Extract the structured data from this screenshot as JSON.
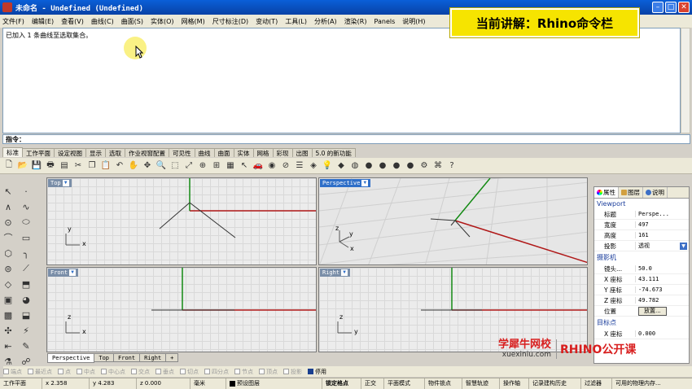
{
  "window": {
    "title": "未命名 - Undefined (Undefined)"
  },
  "menu": [
    "文件(F)",
    "编辑(E)",
    "查看(V)",
    "曲线(C)",
    "曲面(S)",
    "实体(O)",
    "网格(M)",
    "尺寸标注(D)",
    "变动(T)",
    "工具(L)",
    "分析(A)",
    "渲染(R)",
    "Panels",
    "说明(H)"
  ],
  "banner": {
    "text": "当前讲解：Rhino命令栏"
  },
  "history": {
    "line1": "已加入 1 条曲线至选取集合。"
  },
  "command": {
    "prompt": "指令："
  },
  "toolbar_tabs": [
    "标准",
    "工作平面",
    "设定视图",
    "显示",
    "选取",
    "作业视窗配置",
    "可见性",
    "曲线",
    "曲面",
    "实体",
    "网格",
    "彩现",
    "出图",
    "5.0 的新功能"
  ],
  "viewports": {
    "top": "Top",
    "perspective": "Perspective",
    "front": "Front",
    "right": "Right"
  },
  "axis_labels": {
    "x": "x",
    "y": "y",
    "z": "z"
  },
  "viewport_tabs": [
    "Perspective",
    "Top",
    "Front",
    "Right",
    "+"
  ],
  "panel": {
    "tabs": [
      "属性",
      "图层",
      "说明"
    ],
    "section_viewport": "Viewport",
    "rows_viewport": [
      {
        "key": "标题",
        "value": "Perspe..."
      },
      {
        "key": "宽度",
        "value": "497"
      },
      {
        "key": "高度",
        "value": "161"
      },
      {
        "key": "投影",
        "value": "透视"
      }
    ],
    "section_camera": "摄影机",
    "rows_camera": [
      {
        "key": "镜头...",
        "value": "50.0"
      },
      {
        "key": "X 座标",
        "value": "43.111"
      },
      {
        "key": "Y 座标",
        "value": "-74.673"
      },
      {
        "key": "Z 座标",
        "value": "49.782"
      }
    ],
    "position_label": "位置",
    "position_button": "放置...",
    "section_target": "目标点",
    "rows_target": [
      {
        "key": "X 座标",
        "value": "0.000"
      }
    ]
  },
  "osnap": [
    {
      "label": "端点",
      "on": false
    },
    {
      "label": "最近点",
      "on": false
    },
    {
      "label": "点",
      "on": false
    },
    {
      "label": "中点",
      "on": false
    },
    {
      "label": "中心点",
      "on": false
    },
    {
      "label": "交点",
      "on": false
    },
    {
      "label": "垂点",
      "on": false
    },
    {
      "label": "切点",
      "on": false
    },
    {
      "label": "四分点",
      "on": false
    },
    {
      "label": "节点",
      "on": false
    },
    {
      "label": "顶点",
      "on": false
    },
    {
      "label": "投影",
      "on": false
    },
    {
      "label": "停用",
      "on": true
    }
  ],
  "status": {
    "cplane": "工作平面",
    "x": "x 2.358",
    "y": "y 4.283",
    "z": "z 0.000",
    "unit": "毫米",
    "layer": "预设图层",
    "buttons": [
      "锁定格点",
      "正交",
      "平面模式",
      "物件锁点",
      "智慧轨迹",
      "操作轴",
      "记录建构历史",
      "过滤器",
      "可用的物理内存..."
    ]
  },
  "watermark": {
    "cn": "学犀牛网校",
    "url": "xuexiniu.com",
    "course": "RHINO公开课"
  },
  "colors": {
    "title_bar": "#0a5fd8",
    "banner": "#f6e400",
    "x_axis": "#b01818",
    "y_axis": "#138a13",
    "active_viewport": "#2f6fc8"
  }
}
